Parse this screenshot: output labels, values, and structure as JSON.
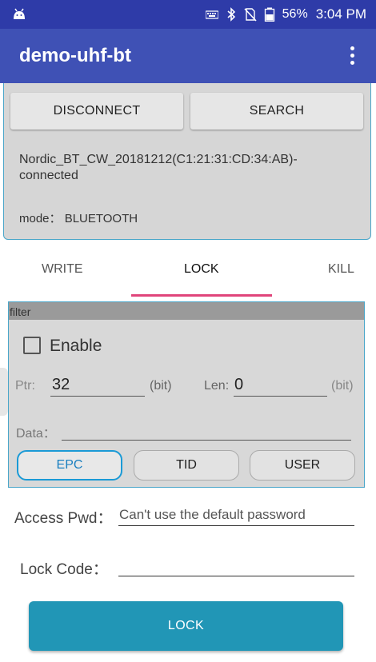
{
  "status_bar": {
    "battery": "56%",
    "time": "3:04 PM",
    "icons": [
      "android-icon",
      "keyboard-icon",
      "bluetooth-icon",
      "no-sim-icon",
      "battery-icon"
    ]
  },
  "app_bar": {
    "title": "demo-uhf-bt",
    "menu_icon": "more-vert-icon"
  },
  "connection": {
    "disconnect_label": "DISCONNECT",
    "search_label": "SEARCH",
    "status_text": "Nordic_BT_CW_20181212(C1:21:31:CD:34:AB)-connected",
    "mode_text": "mode： BLUETOOTH"
  },
  "tabs": {
    "items": [
      "WRITE",
      "LOCK",
      "KILL"
    ],
    "selected": "LOCK",
    "indicator_color": "#e0457b"
  },
  "filter": {
    "header": "filter",
    "enable_label": "Enable",
    "enable_checked": false,
    "ptr_label": "Ptr:",
    "ptr_value": "32",
    "ptr_unit": "(bit)",
    "len_label": "Len:",
    "len_value": "0",
    "len_unit": "(bit)",
    "data_label": "Data：",
    "data_value": "",
    "banks": [
      "EPC",
      "TID",
      "USER"
    ],
    "selected_bank": "EPC"
  },
  "access_pwd": {
    "label": "Access Pwd：",
    "placeholder": "Can't use the default password"
  },
  "lock_code": {
    "label": "Lock Code：",
    "value": ""
  },
  "action": {
    "lock_label": "LOCK",
    "color": "#2196b6"
  },
  "colors": {
    "app_bar": "#3f51b5",
    "status_bar": "#2e3ba8",
    "accent_border": "#4aa6c9"
  }
}
